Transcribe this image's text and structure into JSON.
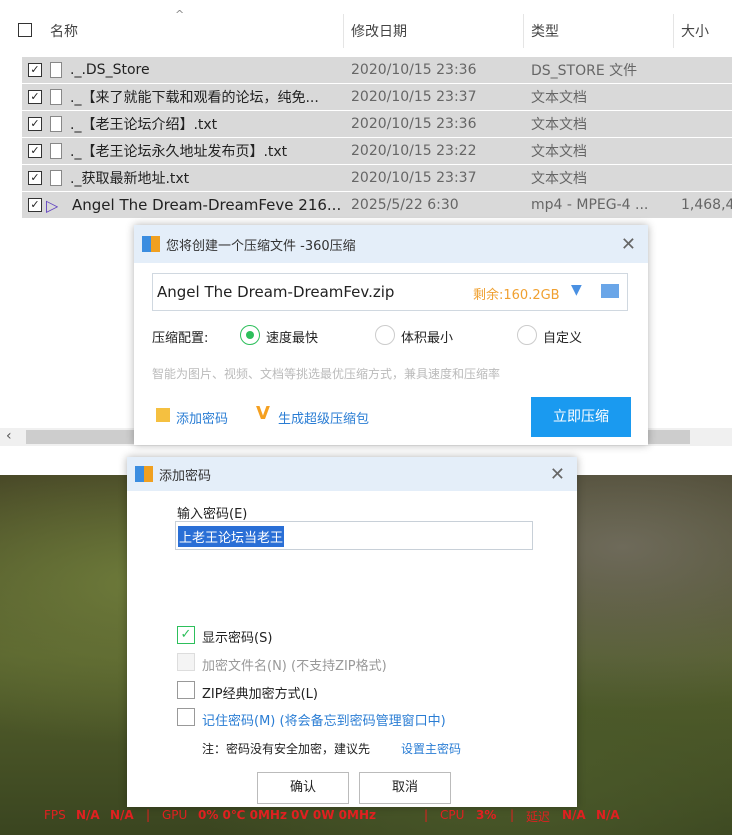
{
  "explorer": {
    "columns": {
      "name": "名称",
      "modified": "修改日期",
      "type": "类型",
      "size": "大小"
    },
    "rows": [
      {
        "name": "._.DS_Store",
        "date": "2020/10/15 23:36",
        "type": "DS_STORE 文件",
        "size": ""
      },
      {
        "name": "._【来了就能下载和观看的论坛，纯免...",
        "date": "2020/10/15 23:37",
        "type": "文本文档",
        "size": ""
      },
      {
        "name": "._【老王论坛介绍】.txt",
        "date": "2020/10/15 23:36",
        "type": "文本文档",
        "size": ""
      },
      {
        "name": "._【老王论坛永久地址发布页】.txt",
        "date": "2020/10/15 23:22",
        "type": "文本文档",
        "size": ""
      },
      {
        "name": "._获取最新地址.txt",
        "date": "2020/10/15 23:37",
        "type": "文本文档",
        "size": ""
      },
      {
        "name": "Angel The Dream-DreamFeve 216...",
        "date": "2025/5/22 6:30",
        "type": "mp4 - MPEG-4 ...",
        "size": "1,468,4"
      }
    ]
  },
  "compress": {
    "title": "您将创建一个压缩文件 -360压缩",
    "filename": "Angel The Dream-DreamFev.zip",
    "free": "剩余:160.2GB",
    "config_label": "压缩配置:",
    "options": [
      "速度最快",
      "体积最小",
      "自定义"
    ],
    "hint": "智能为图片、视频、文档等挑选最优压缩方式，兼具速度和压缩率",
    "add_password": "添加密码",
    "super": "生成超级压缩包",
    "go": "立即压缩"
  },
  "password": {
    "title": "添加密码",
    "label": "输入密码(E)",
    "value": "上老王论坛当老王",
    "show": "显示密码(S)",
    "encrypt_names": "加密文件名(N) (不支持ZIP格式)",
    "zip_classic": "ZIP经典加密方式(L)",
    "remember": "记住密码(M) (将会备忘到密码管理窗口中)",
    "note": "注：密码没有安全加密，建议先",
    "note_link": "设置主密码",
    "ok": "确认",
    "cancel": "取消"
  },
  "hud": {
    "fps": "FPS",
    "fps1": "N/A",
    "fps2": "N/A",
    "gpu": "GPU",
    "gpu_vals": "0% 0℃ 0MHz 0V 0W 0MHz",
    "cpu": "CPU",
    "cpu_val": "3%",
    "lat": "延迟",
    "lat1": "N/A",
    "lat2": "N/A"
  }
}
